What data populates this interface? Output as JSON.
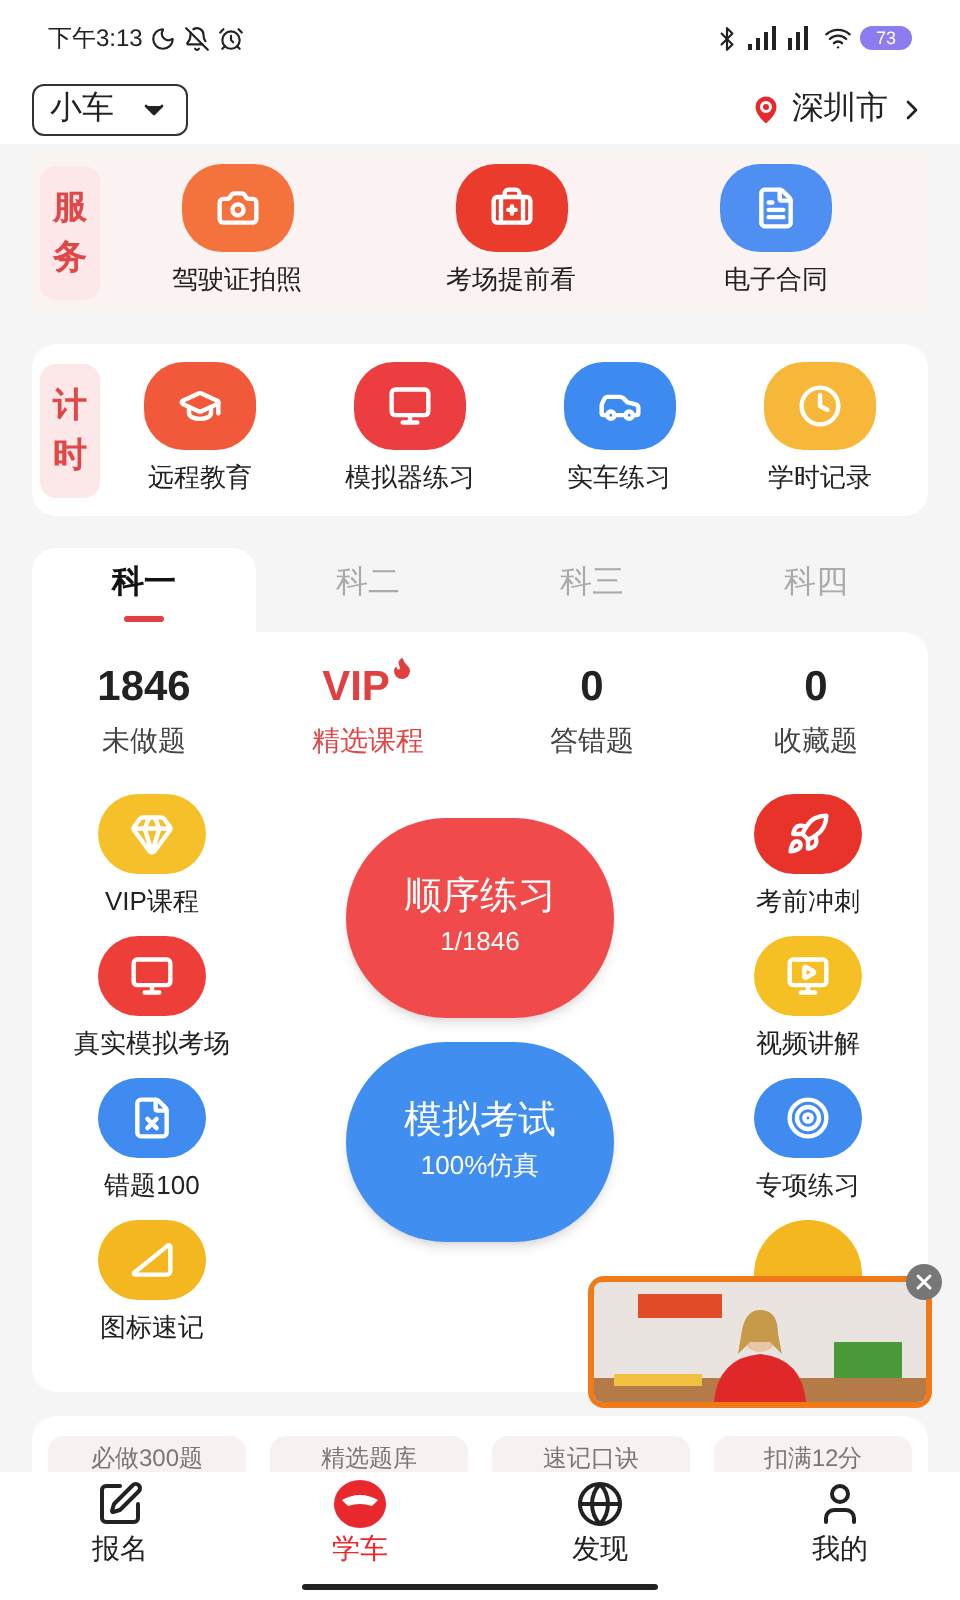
{
  "status_bar": {
    "time": "下午3:13",
    "battery": "73"
  },
  "header": {
    "vehicle": "小车",
    "city": "深圳市"
  },
  "services": {
    "label": "服务",
    "items": [
      {
        "label": "驾驶证拍照",
        "color": "#f4733d"
      },
      {
        "label": "考场提前看",
        "color": "#ea3b2c"
      },
      {
        "label": "电子合同",
        "color": "#4f8ff2"
      }
    ]
  },
  "timing": {
    "label": "计时",
    "items": [
      {
        "label": "远程教育",
        "color": "#f2583a"
      },
      {
        "label": "模拟器练习",
        "color": "#ec3d41"
      },
      {
        "label": "实车练习",
        "color": "#3d8af0"
      },
      {
        "label": "学时记录",
        "color": "#f7b83a"
      }
    ]
  },
  "subject_tabs": [
    {
      "label": "科一",
      "selected": true
    },
    {
      "label": "科二",
      "selected": false
    },
    {
      "label": "科三",
      "selected": false
    },
    {
      "label": "科四",
      "selected": false
    }
  ],
  "stats": [
    {
      "kind": "count",
      "value": "1846",
      "label": "未做题"
    },
    {
      "kind": "vip",
      "value": "VIP",
      "label": "精选课程"
    },
    {
      "kind": "count",
      "value": "0",
      "label": "答错题"
    },
    {
      "kind": "count",
      "value": "0",
      "label": "收藏题"
    }
  ],
  "left_features": [
    {
      "label": "VIP课程",
      "color": "#f5c02a"
    },
    {
      "label": "真实模拟考场",
      "color": "#ee3e3a"
    },
    {
      "label": "错题100",
      "color": "#3f8bf0"
    },
    {
      "label": "图标速记",
      "color": "#f5b71f"
    }
  ],
  "right_features": [
    {
      "label": "考前冲刺",
      "color": "#e8332a"
    },
    {
      "label": "视频讲解",
      "color": "#f5c023"
    },
    {
      "label": "专项练习",
      "color": "#3f8bf0"
    }
  ],
  "practice_buttons": [
    {
      "title": "顺序练习",
      "subtitle": "1/1846",
      "color": "#f04a4a"
    },
    {
      "title": "模拟考试",
      "subtitle": "100%仿真",
      "color": "#3f8ef0"
    }
  ],
  "chips": [
    "必做300题",
    "精选题库",
    "速记口诀",
    "扣满12分"
  ],
  "bottom_nav": [
    {
      "label": "报名",
      "selected": false
    },
    {
      "label": "学车",
      "selected": true
    },
    {
      "label": "发现",
      "selected": false
    },
    {
      "label": "我的",
      "selected": false
    }
  ]
}
